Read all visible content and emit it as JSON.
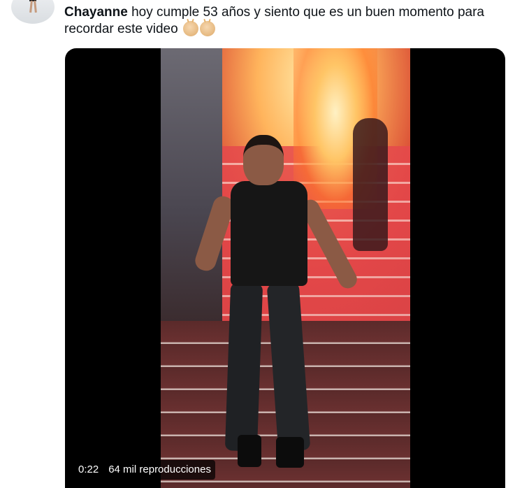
{
  "tweet": {
    "author_name": "Chayanne",
    "text": " hoy cumple 53 años y siento que es un buen momento para recordar este video",
    "emoji": [
      "clapping-hands-emoji",
      "clapping-hands-emoji"
    ]
  },
  "video": {
    "elapsed_time": "0:22",
    "views": "64 mil reproducciones"
  }
}
